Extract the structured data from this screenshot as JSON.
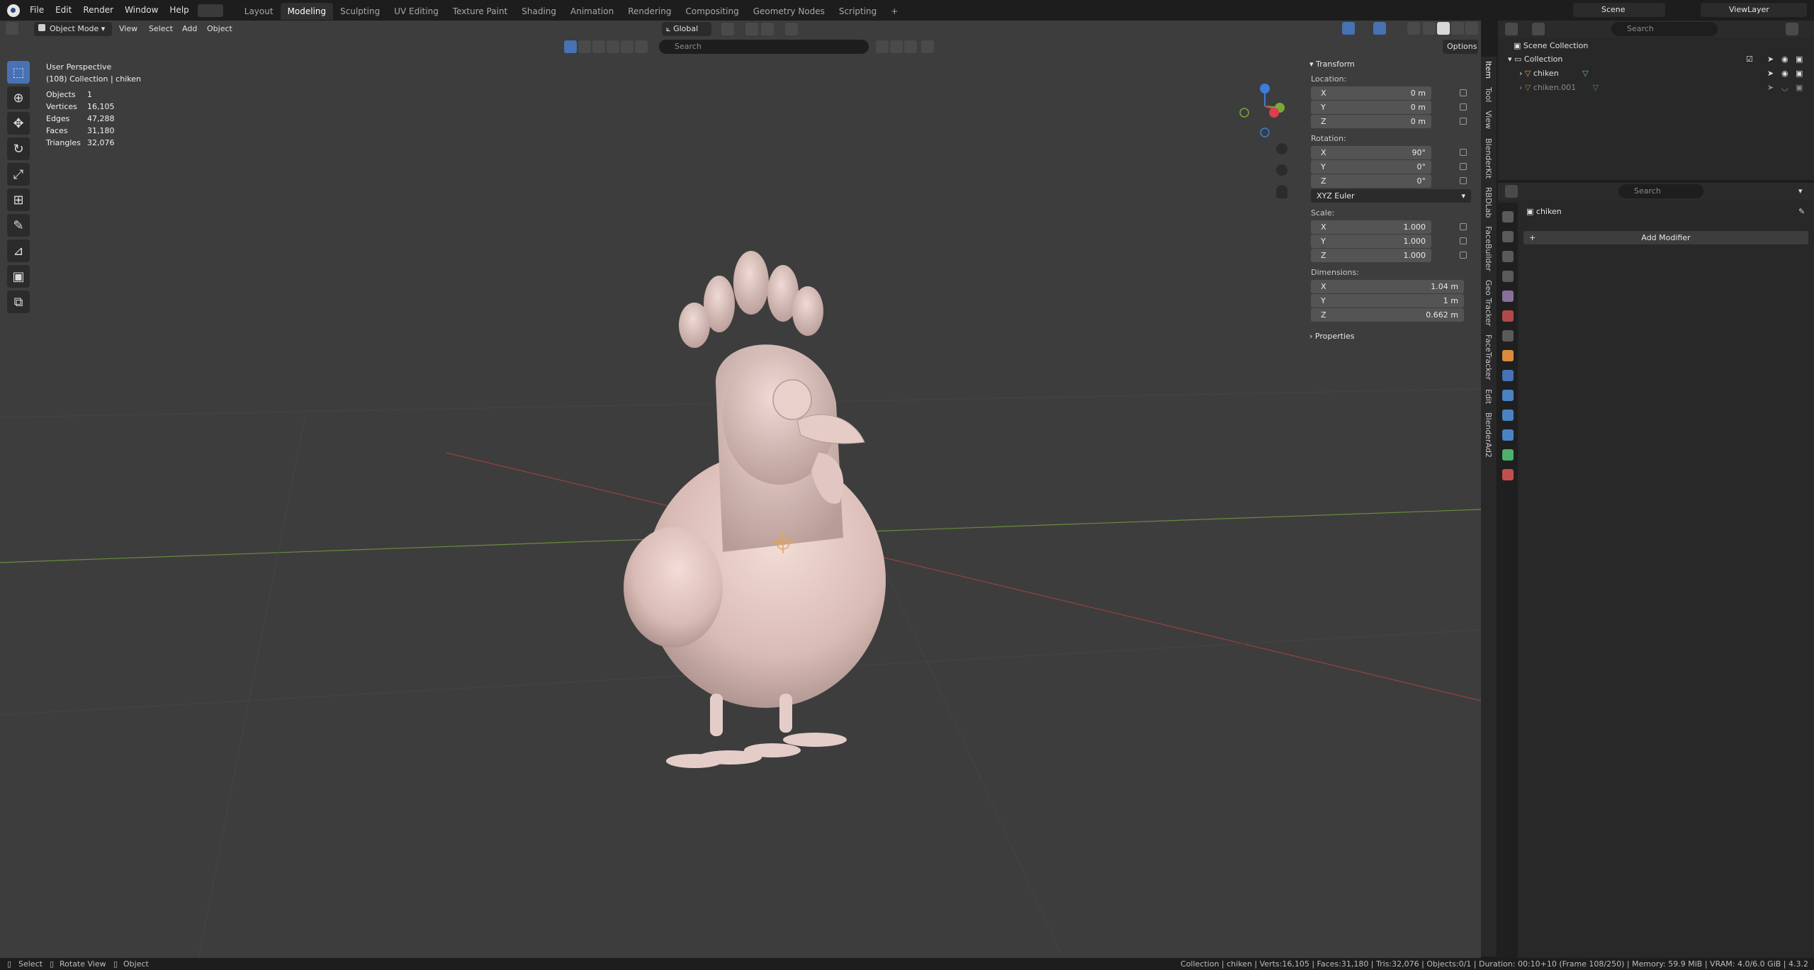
{
  "menu": [
    "File",
    "Edit",
    "Render",
    "Window",
    "Help"
  ],
  "workspaces": [
    "Layout",
    "Modeling",
    "Sculpting",
    "UV Editing",
    "Texture Paint",
    "Shading",
    "Animation",
    "Rendering",
    "Compositing",
    "Geometry Nodes",
    "Scripting"
  ],
  "active_workspace": "Modeling",
  "top_right": {
    "scene_label": "Scene",
    "viewlayer_label": "ViewLayer",
    "plus": "+"
  },
  "viewport_header": {
    "mode": "Object Mode",
    "menus": [
      "View",
      "Select",
      "Add",
      "Object"
    ],
    "transform_orientation": "Global",
    "search_placeholder": "Search",
    "options_label": "Options"
  },
  "overlay": {
    "perspective": "User Perspective",
    "collection_info": "(108) Collection | chiken",
    "stats": [
      {
        "key": "Objects",
        "value": "1"
      },
      {
        "key": "Vertices",
        "value": "16,105"
      },
      {
        "key": "Edges",
        "value": "47,288"
      },
      {
        "key": "Faces",
        "value": "31,180"
      },
      {
        "key": "Triangles",
        "value": "32,076"
      }
    ]
  },
  "npanel": {
    "transform_header": "Transform",
    "location_label": "Location:",
    "location": [
      {
        "axis": "X",
        "value": "0 m"
      },
      {
        "axis": "Y",
        "value": "0 m"
      },
      {
        "axis": "Z",
        "value": "0 m"
      }
    ],
    "rotation_label": "Rotation:",
    "rotation": [
      {
        "axis": "X",
        "value": "90°"
      },
      {
        "axis": "Y",
        "value": "0°"
      },
      {
        "axis": "Z",
        "value": "0°"
      }
    ],
    "rotation_mode": "XYZ Euler",
    "scale_label": "Scale:",
    "scale": [
      {
        "axis": "X",
        "value": "1.000"
      },
      {
        "axis": "Y",
        "value": "1.000"
      },
      {
        "axis": "Z",
        "value": "1.000"
      }
    ],
    "dimensions_label": "Dimensions:",
    "dimensions": [
      {
        "axis": "X",
        "value": "1.04 m"
      },
      {
        "axis": "Y",
        "value": "1 m"
      },
      {
        "axis": "Z",
        "value": "0.662 m"
      }
    ],
    "properties_label": "Properties"
  },
  "side_tabs": [
    "Item",
    "Tool",
    "View",
    "BlenderKit",
    "RBDLab",
    "FaceBuilder",
    "Geo Tracker",
    "FaceTracker",
    "Edit",
    "BlenderAd2"
  ],
  "outliner": {
    "search_placeholder": "Search",
    "scene_collection": "Scene Collection",
    "collection": "Collection",
    "objects": [
      "chiken",
      "chiken.001"
    ]
  },
  "properties": {
    "search_placeholder": "Search",
    "object_name": "chiken",
    "add_modifier": "Add Modifier"
  },
  "statusbar": {
    "left": [
      "Select",
      "Rotate View",
      "Object"
    ],
    "right": "Collection | chiken | Verts:16,105 | Faces:31,180 | Tris:32,076 | Objects:0/1 | Duration: 00:10+10 (Frame 108/250) | Memory: 59.9 MiB | VRAM: 4.0/6.0 GiB | 4.3.2"
  },
  "colors": {
    "accent": "#4772b3",
    "viewport_bg": "#3d3d3d",
    "panel_bg": "#282828"
  }
}
